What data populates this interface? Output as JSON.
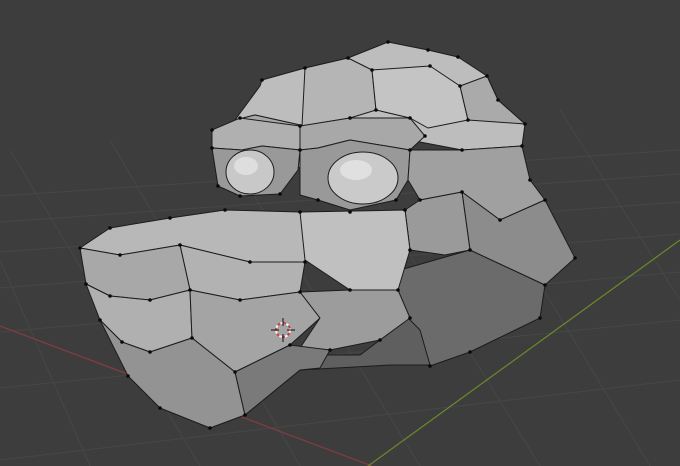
{
  "viewport": {
    "background": "#3d3d3d",
    "grid_color": "#474747",
    "x_axis_color": "#8a3b40",
    "y_axis_color": "#6a8a2a"
  },
  "model": {
    "face_light": "#bdbdbd",
    "face_mid": "#a3a3a3",
    "face_dark": "#6b6b6b",
    "edge_color": "#1c1c1c",
    "vertex_color": "#0a0a0a"
  },
  "cursor": {
    "icon": "3d-cursor-icon",
    "ring_colors": [
      "#d04040",
      "#f0f0f0"
    ]
  }
}
